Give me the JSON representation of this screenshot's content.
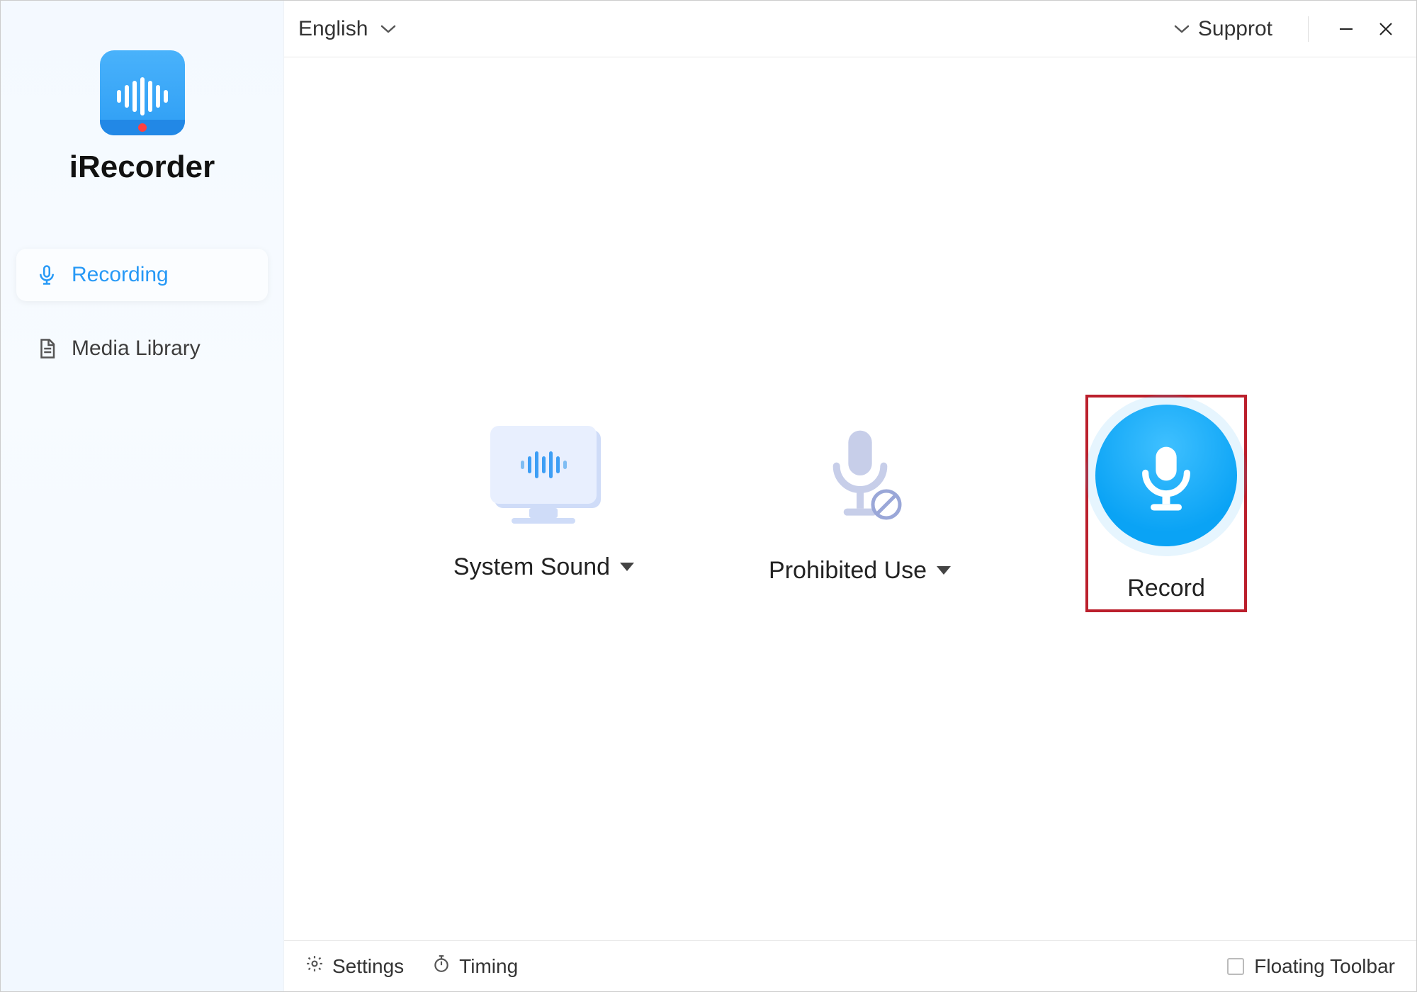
{
  "app": {
    "name": "iRecorder"
  },
  "sidebar": {
    "items": [
      {
        "label": "Recording",
        "icon": "microphone-icon",
        "active": true
      },
      {
        "label": "Media Library",
        "icon": "document-icon",
        "active": false
      }
    ]
  },
  "topbar": {
    "language": "English",
    "support": "Supprot"
  },
  "main": {
    "system_sound": "System Sound",
    "prohibited": "Prohibited Use",
    "record": "Record"
  },
  "footer": {
    "settings": "Settings",
    "timing": "Timing",
    "floating_toolbar": "Floating Toolbar"
  },
  "colors": {
    "accent": "#2799f6",
    "highlight_border": "#bb1f2c"
  }
}
